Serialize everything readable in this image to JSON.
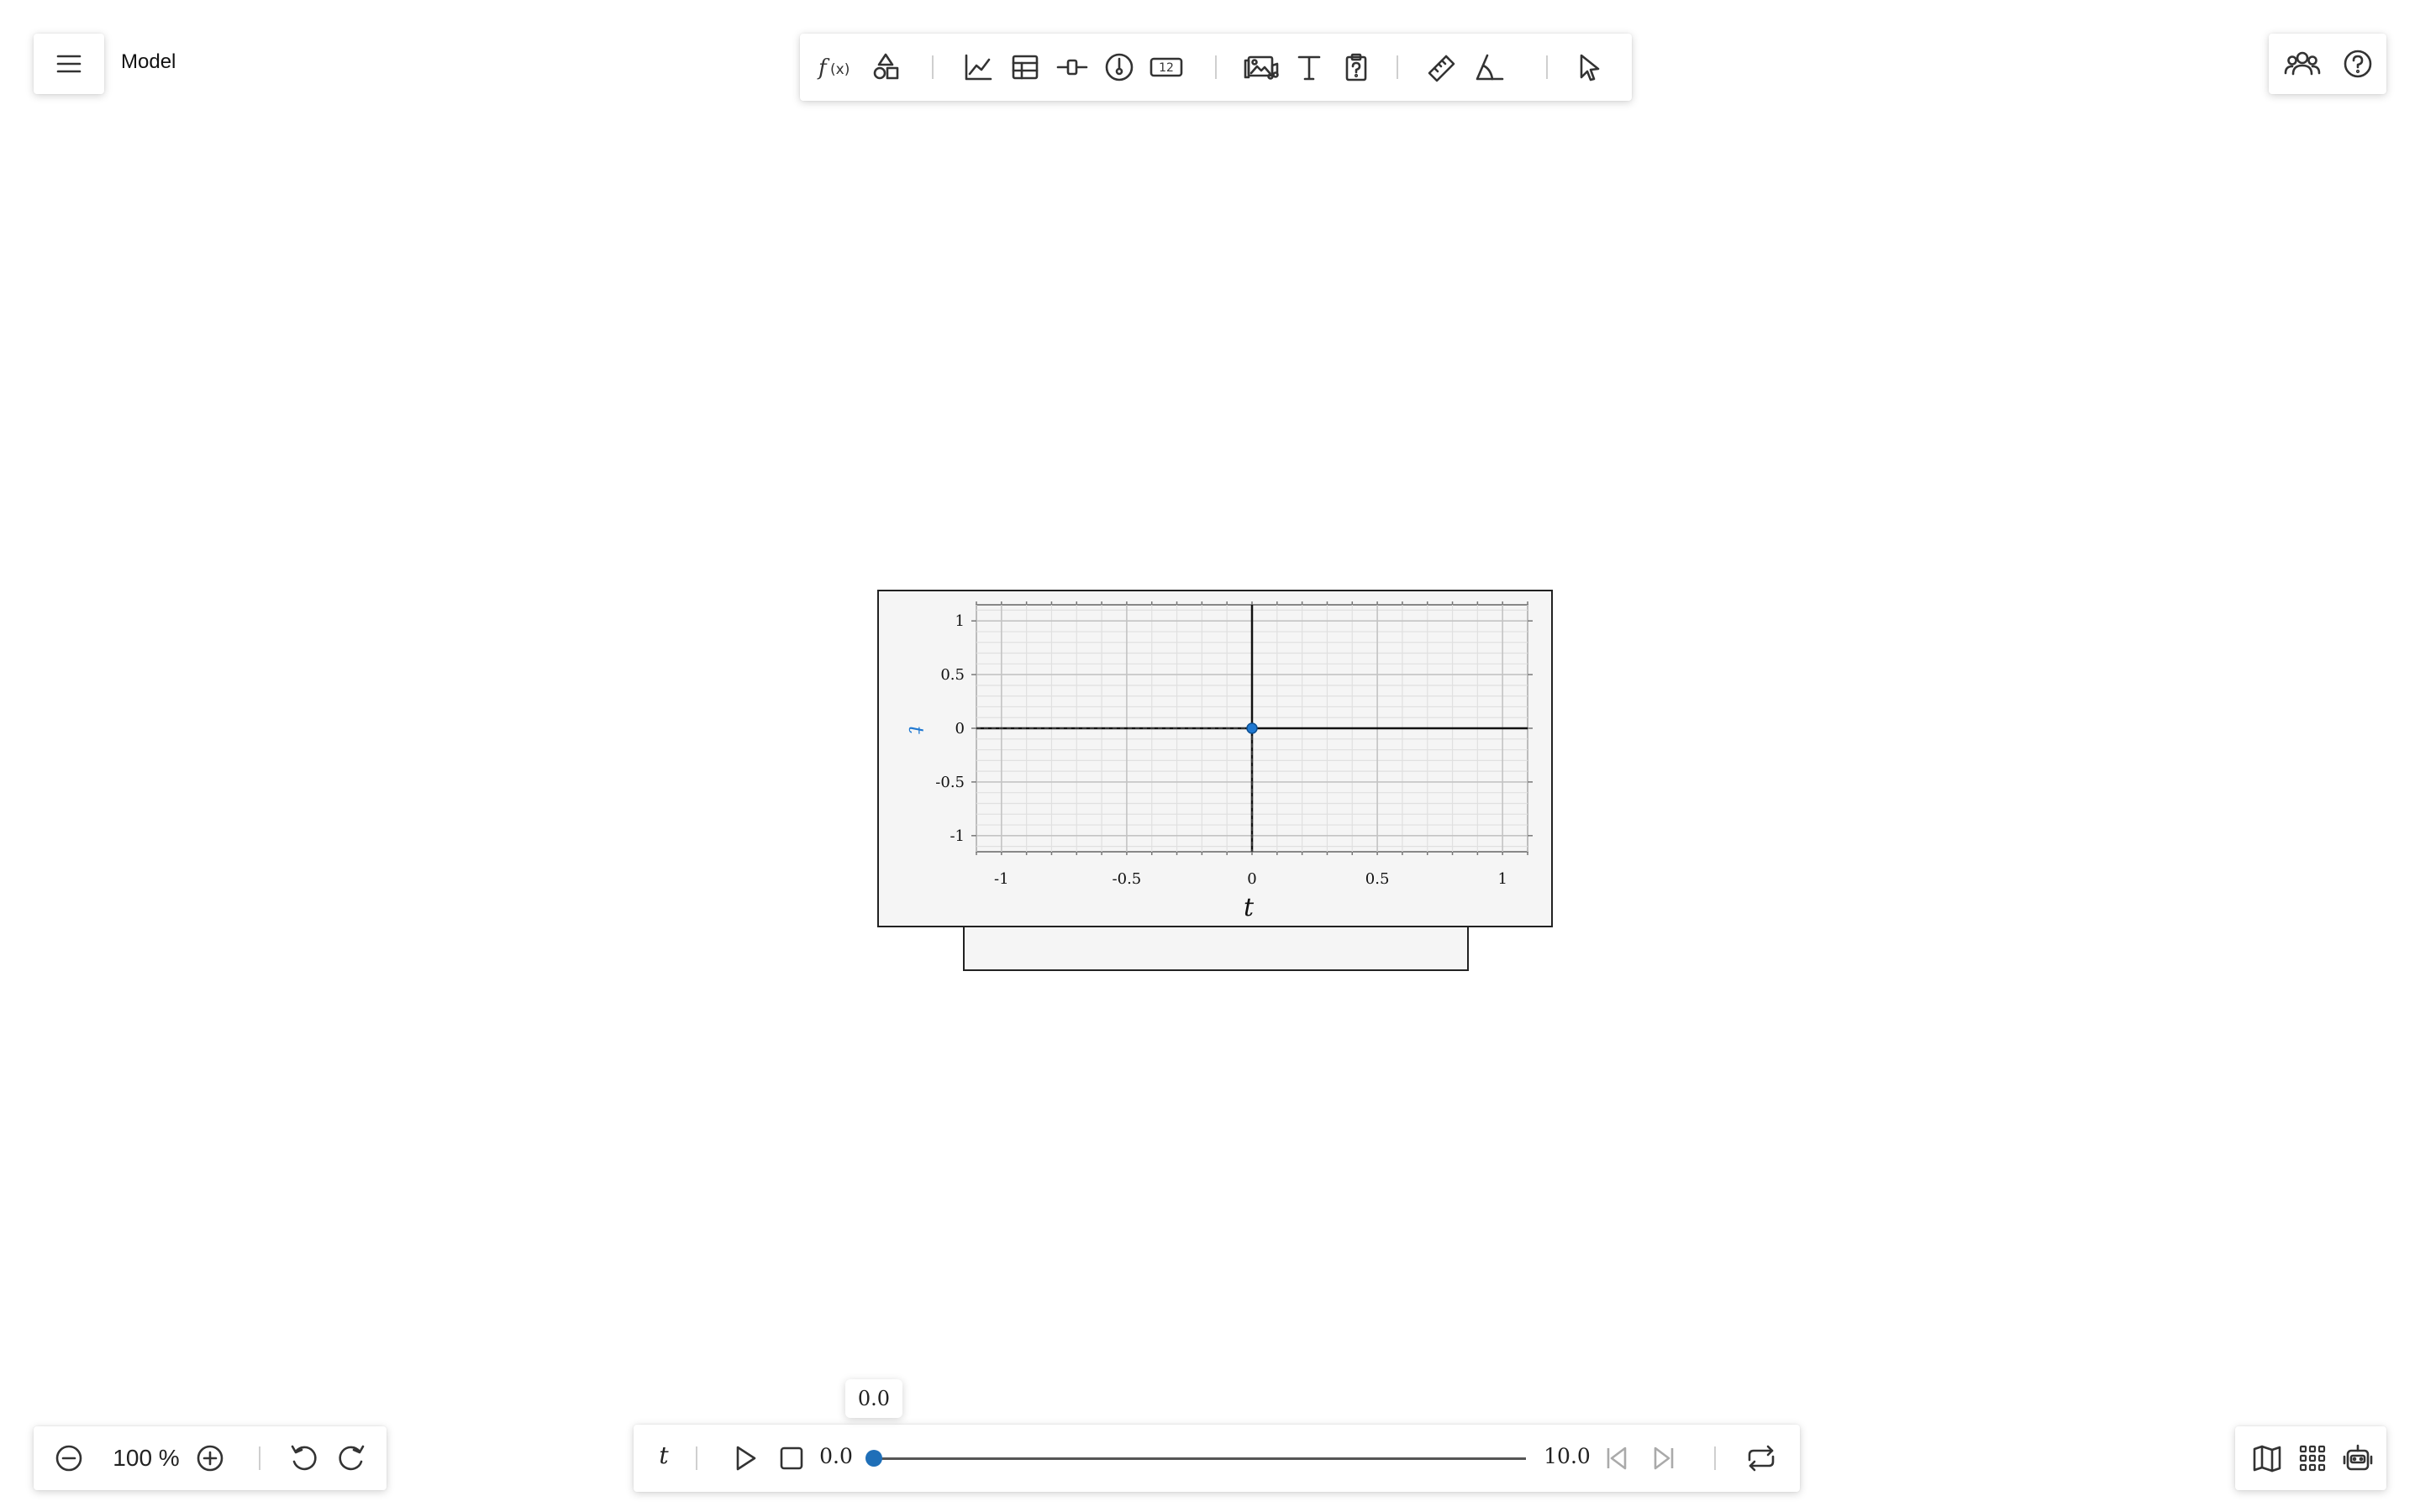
{
  "app": {
    "menu_icon": "hamburger-menu-icon",
    "document_title": "Model"
  },
  "toolbar": {
    "items": [
      {
        "name": "function-tool",
        "icon": "fx-icon",
        "label": "f(x)"
      },
      {
        "name": "shapes-tool",
        "icon": "shapes-icon"
      },
      {
        "name": "graph-tool",
        "icon": "line-graph-icon"
      },
      {
        "name": "table-tool",
        "icon": "table-icon"
      },
      {
        "name": "slider-tool",
        "icon": "slider-icon"
      },
      {
        "name": "gauge-tool",
        "icon": "gauge-icon"
      },
      {
        "name": "number-display-tool",
        "icon": "number-display-icon",
        "label": "12"
      },
      {
        "name": "media-tool",
        "icon": "media-icon"
      },
      {
        "name": "text-tool",
        "icon": "text-icon",
        "label": "T"
      },
      {
        "name": "clipboard-tool",
        "icon": "clipboard-question-icon"
      },
      {
        "name": "ruler-tool",
        "icon": "ruler-icon"
      },
      {
        "name": "angle-tool",
        "icon": "protractor-icon"
      },
      {
        "name": "select-tool",
        "icon": "pointer-icon"
      }
    ]
  },
  "top_right": {
    "collaborators_icon": "collaborators-icon",
    "help_icon": "help-icon"
  },
  "chart_data": {
    "type": "line",
    "xlabel": "t",
    "ylabel": "t",
    "xlim": [
      -1.1,
      1.1
    ],
    "ylim": [
      -1.15,
      1.15
    ],
    "xticks": [
      "-1",
      "-0.5",
      "0",
      "0.5",
      "1"
    ],
    "yticks": [
      "1",
      "0.5",
      "0",
      "-0.5",
      "-1"
    ],
    "xtick_values": [
      -1,
      -0.5,
      0,
      0.5,
      1
    ],
    "ytick_values": [
      1,
      0.5,
      0,
      -0.5,
      -1
    ],
    "grid": true,
    "series": [
      {
        "values": [
          [
            0,
            0
          ]
        ],
        "color": "#1f78d1"
      }
    ]
  },
  "zoom": {
    "zoom_out_icon": "zoom-out-icon",
    "level": "100 %",
    "zoom_in_icon": "zoom-in-icon",
    "undo_icon": "undo-icon",
    "redo_icon": "redo-icon"
  },
  "animation": {
    "variable": "t",
    "play_icon": "play-icon",
    "stop_icon": "stop-icon",
    "start_value": "0.0",
    "end_value": "10.0",
    "current_value_tooltip": "0.0",
    "progress": 0.0,
    "step_back_icon": "step-back-icon",
    "step_forward_icon": "step-forward-icon",
    "loop_icon": "loop-icon"
  },
  "bottom_right": {
    "map_icon": "map-icon",
    "grid_apps_icon": "apps-grid-icon",
    "robot_icon": "robot-icon"
  }
}
